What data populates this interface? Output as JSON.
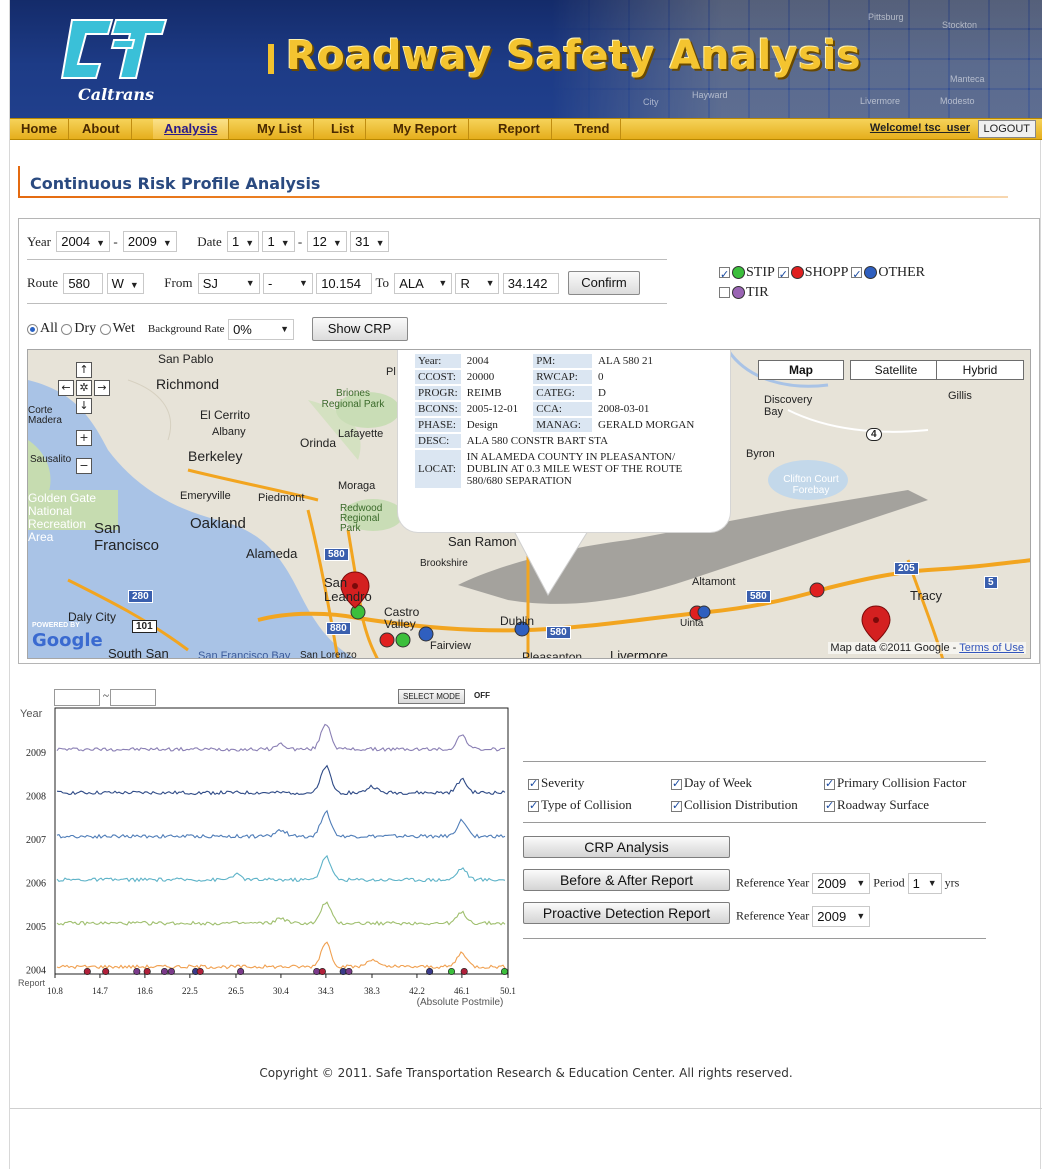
{
  "header": {
    "title": "Roadway Safety Analysis",
    "logo_text": "Caltrans",
    "map_cities": [
      "Pittsburg",
      "Stockton",
      "Manteca",
      "Hayward",
      "Livermore",
      "Modesto",
      "City"
    ]
  },
  "nav": {
    "items": [
      "Home",
      "About",
      "Analysis",
      "My List",
      "List",
      "My Report",
      "Report",
      "Trend"
    ],
    "active": "Analysis",
    "welcome": "Welcome!  tsc_user",
    "logout": "LOGOUT"
  },
  "page_title": "Continuous Risk Profile Analysis",
  "query": {
    "year_label": "Year",
    "year_from": "2004",
    "year_to": "2009",
    "dash": "-",
    "date_label": "Date",
    "date_from_month": "1",
    "date_from_day": "1",
    "date_to_month": "12",
    "date_to_day": "31",
    "route_label": "Route",
    "route": "580",
    "direction": "W",
    "from_label": "From",
    "from_county": "SJ",
    "from_prefix": "-",
    "from_pm": "10.154",
    "to_label": "To",
    "to_county": "ALA",
    "to_prefix": "R",
    "to_pm": "34.142",
    "confirm": "Confirm",
    "conditions": [
      "All",
      "Dry",
      "Wet"
    ],
    "condition_selected": "All",
    "bg_rate_label": "Background Rate",
    "bg_rate": "0%",
    "show_crp": "Show CRP"
  },
  "project_legend": [
    {
      "label": "STIP",
      "checked": true,
      "color": "#3cbf3c"
    },
    {
      "label": "SHOPP",
      "checked": true,
      "color": "#e02020"
    },
    {
      "label": "OTHER",
      "checked": true,
      "color": "#2f5fbf"
    },
    {
      "label": "TIR",
      "checked": false,
      "color": "#9a64b4"
    }
  ],
  "map": {
    "types": [
      "Map",
      "Satellite",
      "Hybrid"
    ],
    "active_type": "Map",
    "labels": [
      "San Pablo",
      "Richmond",
      "Briones Regional Park",
      "Corte Madera",
      "El Cerrito",
      "Albany",
      "Orinda",
      "Lafayette",
      "Berkeley",
      "Sausalito",
      "Emeryville",
      "Piedmont",
      "Moraga",
      "Redwood Regional Park",
      "Golden Gate National Recreation Area",
      "Oakland",
      "San Francisco",
      "Alameda",
      "San Leandro",
      "Castro Valley",
      "Daly City",
      "San Ramon",
      "Brookshire",
      "Dublin",
      "Fairview",
      "Pleasanton",
      "Livermore",
      "Altamont",
      "Tracy",
      "South San",
      "San Francisco Bay",
      "San Lorenzo",
      "Discovery Bay",
      "Gillis",
      "Byron",
      "Clifton Court Forebay",
      "Uinta",
      "Pl"
    ],
    "attribution": "Map data ©2011 Google",
    "terms": "Terms of Use",
    "google": "Google",
    "powered_by": "POWERED BY",
    "shields": [
      "580",
      "880",
      "280",
      "101",
      "205",
      "5",
      "4"
    ],
    "info": {
      "rows": [
        [
          "Year:",
          "2004",
          "PM:",
          "ALA 580 21"
        ],
        [
          "CCOST:",
          "20000",
          "RWCAP:",
          "0"
        ],
        [
          "PROGR:",
          "REIMB",
          "CATEG:",
          "D"
        ],
        [
          "BCONS:",
          "2005-12-01",
          "CCA:",
          "2008-03-01"
        ],
        [
          "PHASE:",
          "Design",
          "MANAG:",
          "GERALD MORGAN"
        ]
      ],
      "desc_label": "DESC:",
      "desc": "ALA 580 CONSTR BART STA",
      "locat_label": "LOCAT:",
      "locat": "IN ALAMEDA COUNTY IN PLEASANTON/ DUBLIN AT 0.3 MILE WEST OF THE ROUTE 580/680 SEPARATION"
    }
  },
  "chart_controls": {
    "range_sep": "~",
    "select_mode": "SELECT MODE",
    "select_state": "OFF"
  },
  "chart_data": {
    "type": "line",
    "title": "",
    "ylabel": "Year",
    "xlabel": "(Absolute Postmile)",
    "x_ticks": [
      "10.8",
      "14.7",
      "18.6",
      "22.5",
      "26.5",
      "30.4",
      "34.3",
      "38.3",
      "42.2",
      "46.1",
      "50.1"
    ],
    "xlim": [
      10.8,
      50.1
    ],
    "series": [
      {
        "name": "2009",
        "color": "#8a7fb4",
        "peaks": [
          [
            34.3,
            1.0
          ],
          [
            46.1,
            0.55
          ],
          [
            30.4,
            0.2
          ]
        ]
      },
      {
        "name": "2008",
        "color": "#2e4a86",
        "peaks": [
          [
            34.3,
            1.0
          ],
          [
            46.1,
            0.5
          ],
          [
            38.3,
            0.25
          ]
        ]
      },
      {
        "name": "2007",
        "color": "#4f7db8",
        "peaks": [
          [
            34.3,
            0.95
          ],
          [
            46.1,
            0.6
          ],
          [
            30.4,
            0.25
          ]
        ]
      },
      {
        "name": "2006",
        "color": "#5eb3c8",
        "peaks": [
          [
            34.3,
            0.9
          ],
          [
            46.1,
            0.45
          ],
          [
            26.5,
            0.2
          ]
        ]
      },
      {
        "name": "2005",
        "color": "#9fbf6e",
        "peaks": [
          [
            34.3,
            0.8
          ],
          [
            46.1,
            0.4
          ],
          [
            30.4,
            0.2
          ]
        ]
      },
      {
        "name": "2004",
        "color": "#f0a050",
        "peaks": [
          [
            34.3,
            0.95
          ],
          [
            46.1,
            0.55
          ],
          [
            38.3,
            0.3
          ]
        ]
      }
    ],
    "report_row_label": "Report",
    "report_markers": [
      {
        "x": 13.6,
        "color": "#b0203a"
      },
      {
        "x": 15.2,
        "color": "#b0203a"
      },
      {
        "x": 17.9,
        "color": "#7a3a8a"
      },
      {
        "x": 18.8,
        "color": "#b0203a"
      },
      {
        "x": 20.3,
        "color": "#7a3a8a"
      },
      {
        "x": 20.9,
        "color": "#7a3a8a"
      },
      {
        "x": 23.0,
        "color": "#3a3a8a"
      },
      {
        "x": 23.4,
        "color": "#b0203a"
      },
      {
        "x": 26.9,
        "color": "#7a3a8a"
      },
      {
        "x": 33.5,
        "color": "#7a3a8a"
      },
      {
        "x": 34.0,
        "color": "#b0203a"
      },
      {
        "x": 35.8,
        "color": "#3a3a8a"
      },
      {
        "x": 36.3,
        "color": "#7a3a8a"
      },
      {
        "x": 43.3,
        "color": "#3a3a8a"
      },
      {
        "x": 45.2,
        "color": "#3cbf3c"
      },
      {
        "x": 46.3,
        "color": "#b0203a"
      },
      {
        "x": 49.8,
        "color": "#3cbf3c"
      }
    ]
  },
  "analysis_options": {
    "checkboxes": [
      {
        "label": "Severity",
        "checked": true
      },
      {
        "label": "Day of Week",
        "checked": true
      },
      {
        "label": "Primary Collision Factor",
        "checked": true
      },
      {
        "label": "Type of Collision",
        "checked": true
      },
      {
        "label": "Collision Distribution",
        "checked": true
      },
      {
        "label": "Roadway Surface",
        "checked": true
      }
    ],
    "crp_button": "CRP Analysis",
    "before_after_button": "Before & After Report",
    "proactive_button": "Proactive Detection Report",
    "reference_year_label": "Reference Year",
    "reference_year_1": "2009",
    "period_label": "Period",
    "period": "1",
    "period_unit": "yrs",
    "reference_year_2": "2009"
  },
  "footer": {
    "text": "Copyright © 2011.  Safe Transportation Research & Education Center.  All rights reserved."
  }
}
